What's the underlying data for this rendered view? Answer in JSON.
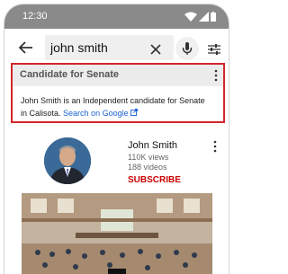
{
  "status_bar": {
    "time": "12:30"
  },
  "search": {
    "query": "john smith"
  },
  "card": {
    "title": "Candidate for Senate",
    "description": "John Smith is an Independent candidate for Senate in Calisota.",
    "link_text": "Search on Google"
  },
  "channel": {
    "name": "John Smith",
    "views": "110K views",
    "videos": "188 videos",
    "subscribe_label": "SUBSCRIBE"
  },
  "colors": {
    "accent_red": "#d3262a",
    "link_blue": "#1a62d1",
    "subscribe_red": "#cc0000"
  }
}
